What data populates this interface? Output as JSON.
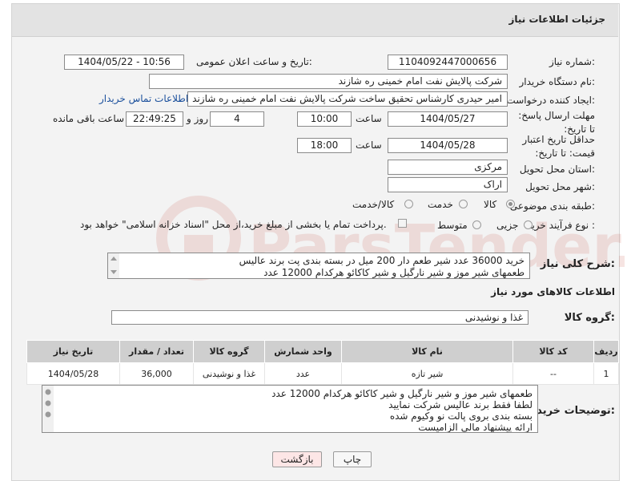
{
  "header": {
    "title": "جزئیات اطلاعات نیاز"
  },
  "fields": {
    "need_number_label": "شماره نیاز:",
    "need_number": "1104092447000656",
    "announce_label": "تاریخ و ساعت اعلان عمومی:",
    "announce_value": "1404/05/22 - 10:56",
    "buyer_org_label": "نام دستگاه خریدار:",
    "buyer_org": "شرکت پالایش نفت امام خمینی  ره  شازند",
    "creator_label": "ایجاد کننده درخواست:",
    "creator": "امیر  حیدری کارشناس تحقیق ساخت شرکت پالایش نفت امام خمینی  ره  شازند",
    "contact_link": "اطلاعات تماس خریدار",
    "deadline_label": "مهلت ارسال پاسخ: تا تاریخ:",
    "deadline_date": "1404/05/27",
    "time_label": "ساعت",
    "deadline_time": "10:00",
    "days_value": "4",
    "days_label": "روز و",
    "remaining_time": "22:49:25",
    "remaining_label": "ساعت باقی مانده",
    "validity_label": "حداقل تاریخ اعتبار قیمت: تا تاریخ:",
    "validity_date": "1404/05/28",
    "validity_time": "18:00",
    "province_label": "استان محل تحویل:",
    "province": "مرکزی",
    "city_label": "شهر محل تحویل:",
    "city": "اراک",
    "category_label": "طبقه بندی موضوعی:",
    "category_options": [
      "کالا",
      "خدمت",
      "کالا/خدمت"
    ],
    "process_label": "نوع فرآیند خرید :",
    "process_options": [
      "جزیی",
      "متوسط"
    ],
    "payment_note": "پرداخت تمام یا بخشی از مبلغ خرید،از محل \"اسناد خزانه اسلامی\" خواهد بود.",
    "summary_label": "شرح کلی نیاز:",
    "summary_line1": "خرید 36000 عدد شیر طعم دار 200 میل در بسته بندی پت برند عالیس",
    "summary_line2": "طعمهای شیر موز و شیر نارگیل و شیر کاکائو هرکدام 12000 عدد"
  },
  "goods_section": {
    "title": "اطلاعات کالاهای مورد نیاز",
    "group_label": "گروه کالا:",
    "group_value": "غذا و نوشیدنی"
  },
  "table": {
    "headers": [
      "ردیف",
      "کد کالا",
      "نام کالا",
      "واحد شمارش",
      "گروه کالا",
      "تعداد / مقدار",
      "تاریخ نیاز"
    ],
    "rows": [
      [
        "1",
        "--",
        "شیر تازه",
        "عدد",
        "غذا و نوشیدنی",
        "36,000",
        "1404/05/28"
      ]
    ]
  },
  "buyer_notes": {
    "label": "توضیحات خریدار:",
    "lines": [
      "طعمهای شیر موز و شیر نارگیل و شیر کاکائو هرکدام 12000 عدد",
      "لطفا فقط برند عالیس شرکت نمایید",
      "بسته بندی بروی پالت نو وکیوم شده",
      "ارائه پیشنهاد مالی الزامیست"
    ]
  },
  "buttons": {
    "print": "چاپ",
    "back": "بازگشت"
  },
  "colors": {
    "link": "#1a4f9c",
    "back_button_bg": "#fde6e6",
    "table_header_bg": "#cfcfcf"
  }
}
